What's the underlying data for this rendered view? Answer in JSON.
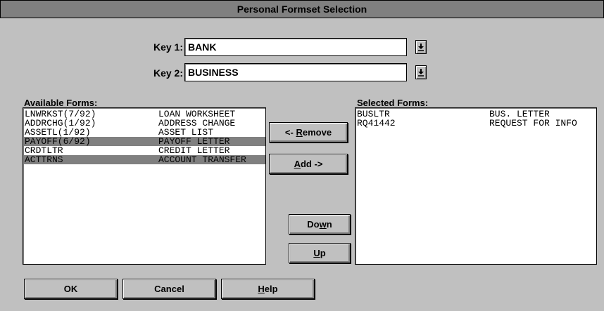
{
  "dialog": {
    "title": "Personal Formset Selection"
  },
  "keys": {
    "key1": {
      "label": "Key 1:",
      "value": "BANK"
    },
    "key2": {
      "label": "Key 2:",
      "value": "BUSINESS"
    }
  },
  "available": {
    "label": "Available Forms:",
    "items": [
      {
        "code": "LNWRKST(7/92)",
        "desc": "LOAN WORKSHEET",
        "selected": false
      },
      {
        "code": "ADDRCHG(1/92)",
        "desc": "ADDRESS CHANGE",
        "selected": false
      },
      {
        "code": "ASSETL(1/92)",
        "desc": "ASSET LIST",
        "selected": false
      },
      {
        "code": "PAYOFF(6/92)",
        "desc": "PAYOFF LETTER",
        "selected": true
      },
      {
        "code": "CRDTLTR",
        "desc": "CREDIT LETTER",
        "selected": false
      },
      {
        "code": "ACTTRNS",
        "desc": "ACCOUNT TRANSFER",
        "selected": true
      }
    ]
  },
  "selected": {
    "label": "Selected Forms:",
    "items": [
      {
        "code": "BUSLTR",
        "desc": "BUS. LETTER"
      },
      {
        "code": "RQ41442",
        "desc": "REQUEST FOR INFO"
      }
    ]
  },
  "buttons": {
    "remove": {
      "pre": "<- ",
      "accel": "R",
      "post": "emove"
    },
    "add": {
      "pre": "",
      "accel": "A",
      "post": "dd ->"
    },
    "down": {
      "pre": "Do",
      "accel": "w",
      "post": "n"
    },
    "up": {
      "pre": "",
      "accel": "U",
      "post": "p"
    },
    "ok": {
      "label": "OK"
    },
    "cancel": {
      "label": "Cancel"
    },
    "help": {
      "pre": "",
      "accel": "H",
      "post": "elp"
    }
  }
}
